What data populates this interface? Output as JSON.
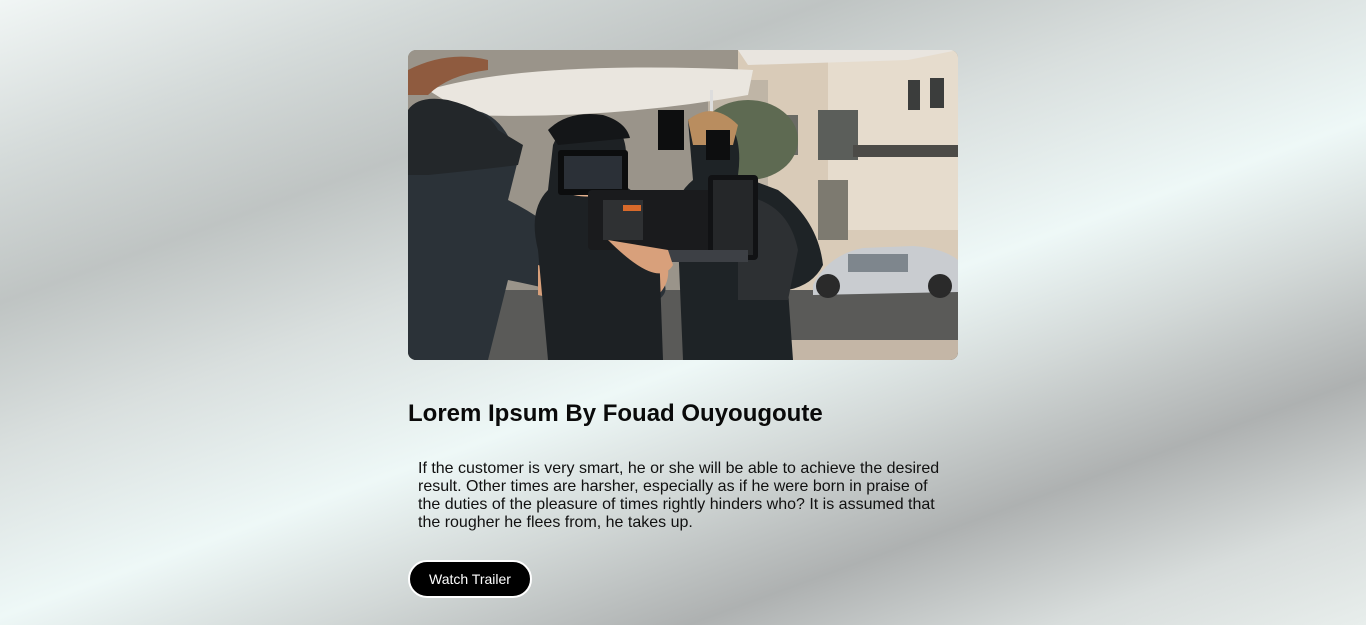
{
  "hero": {
    "alt": "Film crew operating a cinema camera outdoors"
  },
  "movie": {
    "title": "Lorem Ipsum By Fouad Ouyougoute",
    "description": "If the customer is very smart, he or she will be able to achieve the desired result. Other times are harsher, especially as if he were born in praise of the duties of the pleasure of times rightly hinders who? It is assumed that the rougher he flees from, he takes up.",
    "cta_label": "Watch Trailer"
  },
  "colors": {
    "button_bg": "#000000",
    "button_text": "#ffffff",
    "text": "#0a0a0a"
  }
}
